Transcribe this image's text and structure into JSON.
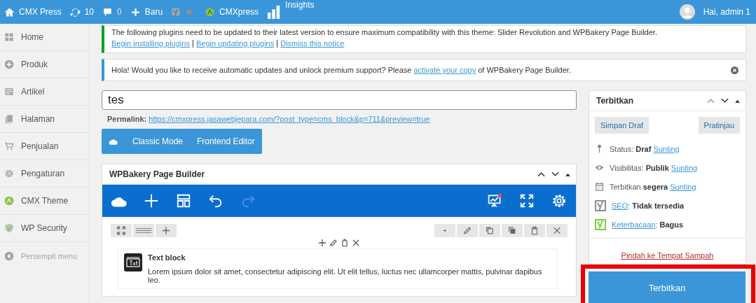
{
  "admin_bar": {
    "site": "CMX Press",
    "updates": "10",
    "comments": "0",
    "new": "Baru",
    "theme": "CMXpress",
    "insights": "Insights",
    "greeting": "Hai, admin 1"
  },
  "sidebar": {
    "items": [
      {
        "label": "Home"
      },
      {
        "label": "Produk"
      },
      {
        "label": "Artikel"
      },
      {
        "label": "Halaman"
      },
      {
        "label": "Penjualan"
      },
      {
        "label": "Pengaturan"
      },
      {
        "label": "CMX Theme"
      },
      {
        "label": "WP Security"
      }
    ],
    "collapse": "Persempit menu"
  },
  "plugin_notice": {
    "text": "The following plugins need to be updated to their latest version to ensure maximum compatibility with this theme: Slider Revolution and WPBakery Page Builder.",
    "links": [
      "Begin installing plugins",
      "Begin updating plugins",
      "Dismiss this notice"
    ]
  },
  "info_notice": {
    "before": "Hola! Would you like to receive automatic updates and unlock premium support? Please ",
    "link": "activate your copy",
    "after": " of WPBakery Page Builder."
  },
  "editor": {
    "title": "tes",
    "permalink_label": "Permalink:",
    "permalink": "https://cmxpress.jasawebjepara.com/?post_type=cms_block&p=711&preview=true",
    "modes": [
      "Classic Mode",
      "Frontend Editor"
    ]
  },
  "builder": {
    "title": "WPBakery Page Builder",
    "element_title": "Text block",
    "element_text": "Lorem ipsum dolor sit amet, consectetur adipiscing elit. Ut elit tellus, luctus nec ullamcorper mattis, pulvinar dapibus leo."
  },
  "publish": {
    "title": "Terbitkan",
    "save": "Simpan Draf",
    "preview": "Pratinjau",
    "rows": [
      {
        "kind": "meta",
        "label": "Status:",
        "value": "Draf",
        "link": "Sunting"
      },
      {
        "kind": "meta",
        "label": "Visibilitas:",
        "value": "Publik",
        "link": "Sunting"
      },
      {
        "kind": "meta",
        "label": "Terbitkan",
        "value": "segera",
        "link": "Sunting"
      },
      {
        "kind": "score",
        "link": "SEO",
        "separator": ":",
        "value": "Tidak tersedia",
        "color": "#8c8f94"
      },
      {
        "kind": "score",
        "link": "Keterbacaan",
        "separator": ":",
        "value": "Bagus",
        "color": "#7ad03a"
      }
    ],
    "trash": "Pindah ke Tempat Sampah",
    "button": "Terbitkan",
    "highlighted": true
  }
}
